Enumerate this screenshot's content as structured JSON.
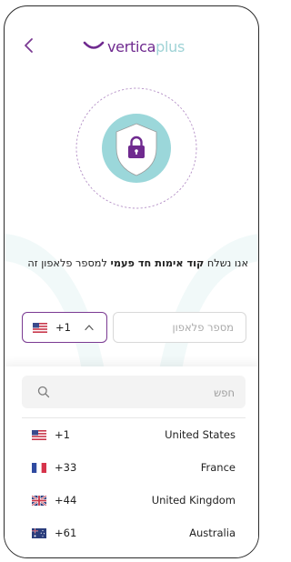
{
  "header": {
    "back_icon": "chevron-left-icon",
    "logo_primary": "vertica",
    "logo_secondary": "plus"
  },
  "hero": {
    "icon": "shield-lock-icon"
  },
  "message": {
    "prefix": "אנו נשלח ",
    "bold": "קוד אימות חד פעמי",
    "suffix": " למספר פלאפון זה"
  },
  "phone_entry": {
    "selected_flag": "us-flag-icon",
    "selected_code": "+1",
    "phone_placeholder": "מספר פלאפון",
    "phone_value": ""
  },
  "country_dropdown": {
    "search_placeholder": "חפש",
    "options": [
      {
        "flag": "us-flag-icon",
        "code": "+1",
        "name": "United States"
      },
      {
        "flag": "fr-flag-icon",
        "code": "+33",
        "name": "France"
      },
      {
        "flag": "uk-flag-icon",
        "code": "+44",
        "name": "United Kingdom"
      },
      {
        "flag": "au-flag-icon",
        "code": "+61",
        "name": "Australia"
      }
    ]
  },
  "colors": {
    "brand_purple": "#6f2a8f",
    "brand_teal": "#9fd3d6",
    "frame": "#2b2b2b"
  }
}
